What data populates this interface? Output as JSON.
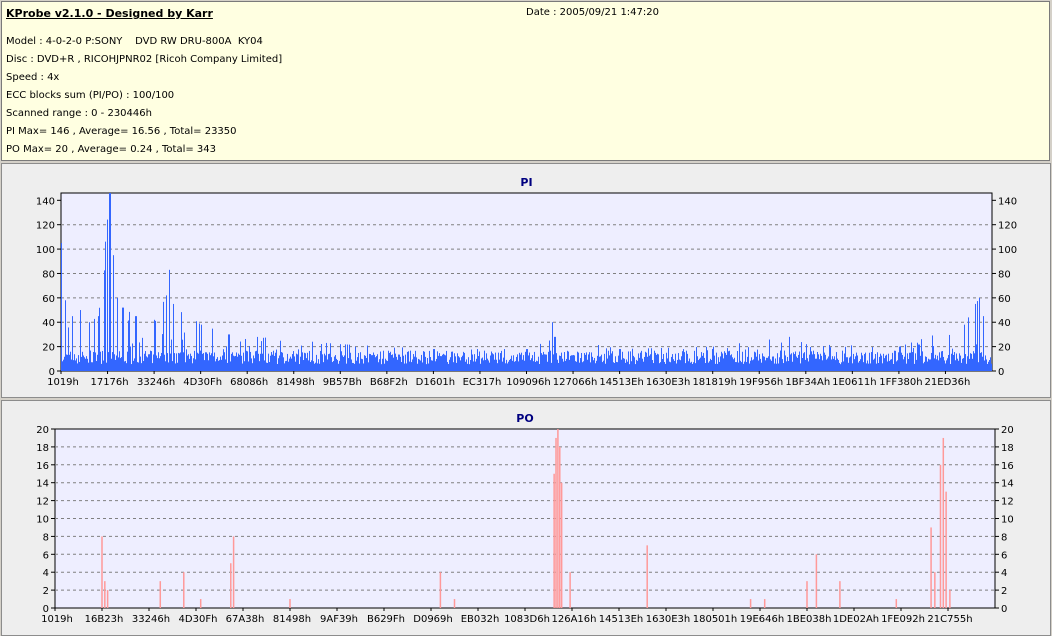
{
  "info": {
    "title": "KProbe v2.1.0 - Designed by Karr",
    "date": "Date : 2005/09/21 1:47:20",
    "lines": [
      "Model : 4-0-2-0 P:SONY    DVD RW DRU-800A  KY04",
      "Disc : DVD+R , RICOHJPNR02 [Ricoh Company Limited]",
      "Speed : 4x",
      "ECC blocks sum (PI/PO) : 100/100",
      "Scanned range : 0 - 230446h",
      "PI Max= 146 , Average= 16.56 , Total= 23350",
      "PO Max= 20 , Average= 0.24 , Total= 343"
    ]
  },
  "chart_data": [
    {
      "type": "bar",
      "title": "PI",
      "color": "#3366ff",
      "ylim": [
        0,
        146
      ],
      "yticks": [
        0,
        20,
        40,
        60,
        80,
        100,
        120,
        140
      ],
      "grid": true,
      "xticks": [
        "1019h",
        "17176h",
        "33246h",
        "4D30Fh",
        "68086h",
        "81498h",
        "9B57Bh",
        "B68F2h",
        "D1601h",
        "EC317h",
        "109096h",
        "127066h",
        "14513Eh",
        "1630E3h",
        "181819h",
        "19F956h",
        "1BF34Ah",
        "1E0611h",
        "1FF380h",
        "21ED36h"
      ],
      "x_range": [
        0,
        1
      ],
      "baseline": 14,
      "peaks": [
        {
          "x": 0.0,
          "y": 105
        },
        {
          "x": 0.004,
          "y": 58
        },
        {
          "x": 0.012,
          "y": 45
        },
        {
          "x": 0.02,
          "y": 50
        },
        {
          "x": 0.03,
          "y": 40
        },
        {
          "x": 0.04,
          "y": 45
        },
        {
          "x": 0.052,
          "y": 146
        },
        {
          "x": 0.056,
          "y": 95
        },
        {
          "x": 0.06,
          "y": 60
        },
        {
          "x": 0.066,
          "y": 52
        },
        {
          "x": 0.08,
          "y": 45
        },
        {
          "x": 0.1,
          "y": 42
        },
        {
          "x": 0.113,
          "y": 62
        },
        {
          "x": 0.116,
          "y": 83
        },
        {
          "x": 0.12,
          "y": 55
        },
        {
          "x": 0.15,
          "y": 38
        },
        {
          "x": 0.18,
          "y": 30
        },
        {
          "x": 0.3,
          "y": 22
        },
        {
          "x": 0.4,
          "y": 18
        },
        {
          "x": 0.5,
          "y": 18
        },
        {
          "x": 0.524,
          "y": 25
        },
        {
          "x": 0.527,
          "y": 40
        },
        {
          "x": 0.53,
          "y": 28
        },
        {
          "x": 0.6,
          "y": 18
        },
        {
          "x": 0.7,
          "y": 20
        },
        {
          "x": 0.782,
          "y": 28
        },
        {
          "x": 0.8,
          "y": 22
        },
        {
          "x": 0.9,
          "y": 20
        },
        {
          "x": 0.97,
          "y": 38
        },
        {
          "x": 0.982,
          "y": 55
        },
        {
          "x": 0.986,
          "y": 60
        },
        {
          "x": 0.99,
          "y": 45
        },
        {
          "x": 1.0,
          "y": 30
        }
      ]
    },
    {
      "type": "bar",
      "title": "PO",
      "color": "#ff9999",
      "ylim": [
        0,
        20
      ],
      "yticks": [
        0,
        2,
        4,
        6,
        8,
        10,
        12,
        14,
        16,
        18,
        20
      ],
      "grid": true,
      "xticks": [
        "1019h",
        "16B23h",
        "33246h",
        "4D30Fh",
        "67A38h",
        "81498h",
        "9AF39h",
        "B629Fh",
        "D0969h",
        "EB032h",
        "1083D6h",
        "126A16h",
        "14513Eh",
        "1630E3h",
        "180501h",
        "19E646h",
        "1BE038h",
        "1DE02Ah",
        "1FE092h",
        "21C755h"
      ],
      "x_range": [
        0,
        1
      ],
      "spikes": [
        {
          "x": 0.05,
          "y": 8
        },
        {
          "x": 0.053,
          "y": 3
        },
        {
          "x": 0.056,
          "y": 2
        },
        {
          "x": 0.112,
          "y": 3
        },
        {
          "x": 0.137,
          "y": 4
        },
        {
          "x": 0.155,
          "y": 1
        },
        {
          "x": 0.187,
          "y": 5
        },
        {
          "x": 0.19,
          "y": 8
        },
        {
          "x": 0.25,
          "y": 1
        },
        {
          "x": 0.41,
          "y": 4
        },
        {
          "x": 0.425,
          "y": 1
        },
        {
          "x": 0.531,
          "y": 15
        },
        {
          "x": 0.533,
          "y": 19
        },
        {
          "x": 0.535,
          "y": 20
        },
        {
          "x": 0.537,
          "y": 18
        },
        {
          "x": 0.539,
          "y": 14
        },
        {
          "x": 0.548,
          "y": 4
        },
        {
          "x": 0.63,
          "y": 7
        },
        {
          "x": 0.74,
          "y": 1
        },
        {
          "x": 0.755,
          "y": 1
        },
        {
          "x": 0.8,
          "y": 3
        },
        {
          "x": 0.81,
          "y": 6
        },
        {
          "x": 0.835,
          "y": 3
        },
        {
          "x": 0.895,
          "y": 1
        },
        {
          "x": 0.932,
          "y": 9
        },
        {
          "x": 0.936,
          "y": 4
        },
        {
          "x": 0.942,
          "y": 16
        },
        {
          "x": 0.945,
          "y": 19
        },
        {
          "x": 0.948,
          "y": 13
        },
        {
          "x": 0.952,
          "y": 2
        }
      ]
    }
  ]
}
